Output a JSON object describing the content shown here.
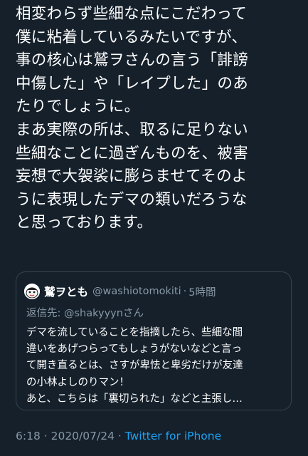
{
  "tweet": {
    "lines": [
      "相変わらず些細な点にこだわって",
      "僕に粘着しているみたいですが、",
      "事の核心は鷲ヲさんの言う「誹謗",
      "中傷した」や「レイプした」のあ",
      "たりでしょうに。",
      "まあ実際の所は、取るに足りない",
      "些細なことに過ぎんものを、被害",
      "妄想で大袈裟に膨らませてそのよ",
      "うに表現したデマの類いだろうな",
      "と思っております。"
    ]
  },
  "quote": {
    "name": "鷲ヲとも",
    "handle": "@washiotomokiti",
    "dot": "·",
    "time": "5時間",
    "reply_prefix": "返信先: ",
    "reply_mention": "@shakyyynさん",
    "lines": [
      "デマを流していることを指摘したら、些細な間",
      "違いをあげつらってもしょうがないなどと言っ",
      "て開き直るとは、さすが卑怯と卑劣だけが友達",
      "の小林よしのりマン！",
      "あと、こちらは「裏切られた」などと主張し…"
    ],
    "avatar_icon": "avatar-face-icon"
  },
  "meta": {
    "time": "6:18",
    "sep1": " · ",
    "date": "2020/07/24",
    "sep2": " · ",
    "source": "Twitter for iPhone"
  },
  "colors": {
    "background": "#15202b",
    "secondary_text": "#8899a6",
    "link": "#1da1f2",
    "border": "#38444d"
  }
}
